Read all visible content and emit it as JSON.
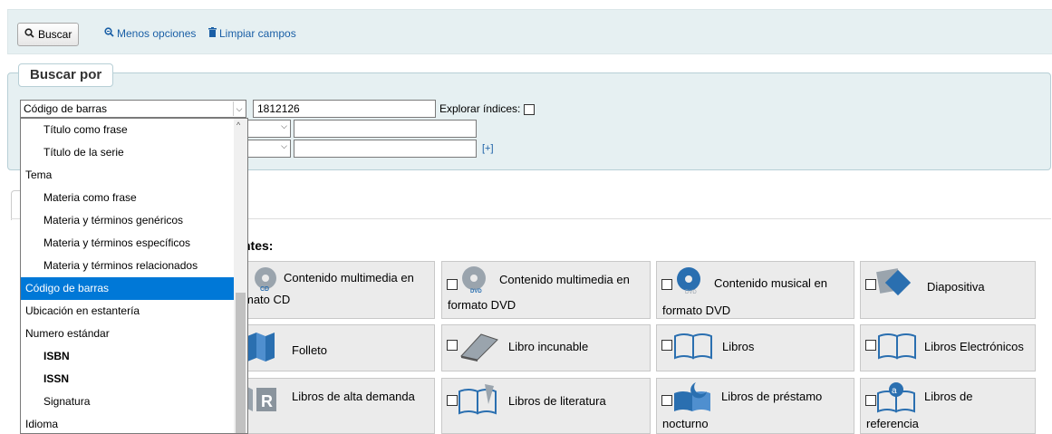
{
  "toolbar": {
    "search_label": "Buscar",
    "fewer_options_label": "Menos opciones",
    "clear_fields_label": "Limpiar campos"
  },
  "search_by": {
    "legend": "Buscar por",
    "field_selected": "Código de barras",
    "search_value": "1812126",
    "browse_indexes_label": "Explorar índices:",
    "add_row_label": "[+]"
  },
  "dropdown": {
    "items": [
      {
        "label": "Título como frase",
        "type": "sub"
      },
      {
        "label": "Título de la serie",
        "type": "sub"
      },
      {
        "label": "Tema",
        "type": "group"
      },
      {
        "label": "Materia como frase",
        "type": "sub"
      },
      {
        "label": "Materia y términos genéricos",
        "type": "sub"
      },
      {
        "label": "Materia y términos específicos",
        "type": "sub"
      },
      {
        "label": "Materia y términos relacionados",
        "type": "sub"
      },
      {
        "label": "Código de barras",
        "type": "group",
        "selected": true
      },
      {
        "label": "Ubicación en estantería",
        "type": "group"
      },
      {
        "label": "Numero estándar",
        "type": "group"
      },
      {
        "label": "ISBN",
        "type": "sub"
      },
      {
        "label": "ISSN",
        "type": "sub"
      },
      {
        "label": "Signatura",
        "type": "sub"
      },
      {
        "label": "Idioma",
        "type": "group"
      }
    ]
  },
  "item_types": {
    "heading_partial": "ntes:",
    "tiles": [
      {
        "line1": "Contenido multimedia en",
        "line2": "mato CD",
        "icon": "cd-icon"
      },
      {
        "line1": "Contenido multimedia en",
        "line2": "formato DVD",
        "icon": "dvd-icon"
      },
      {
        "line1": "Contenido musical en",
        "line2": "formato DVD",
        "icon": "music-dvd-icon"
      },
      {
        "line1": "Diapositiva",
        "line2": "",
        "icon": "slide-icon"
      },
      {
        "line1": "Folleto",
        "line2": "",
        "icon": "brochure-icon"
      },
      {
        "line1": "Libro incunable",
        "line2": "",
        "icon": "old-book-icon"
      },
      {
        "line1": "Libros",
        "line2": "",
        "icon": "book-icon"
      },
      {
        "line1": "Libros Electrónicos",
        "line2": "",
        "icon": "ebook-icon"
      },
      {
        "line1": "Libros de alta demanda",
        "line2": "",
        "icon": "reserve-icon"
      },
      {
        "line1": "Libros de literatura",
        "line2": "",
        "icon": "literature-icon"
      },
      {
        "line1": "Libros de préstamo",
        "line2": "nocturno",
        "icon": "night-loan-icon"
      },
      {
        "line1": "Libros de",
        "line2": "referencia",
        "icon": "reference-icon"
      }
    ]
  },
  "colors": {
    "accent_blue": "#1a5fa6",
    "selected_bg": "#0078d7",
    "panel_bg": "#e6f0f2"
  }
}
